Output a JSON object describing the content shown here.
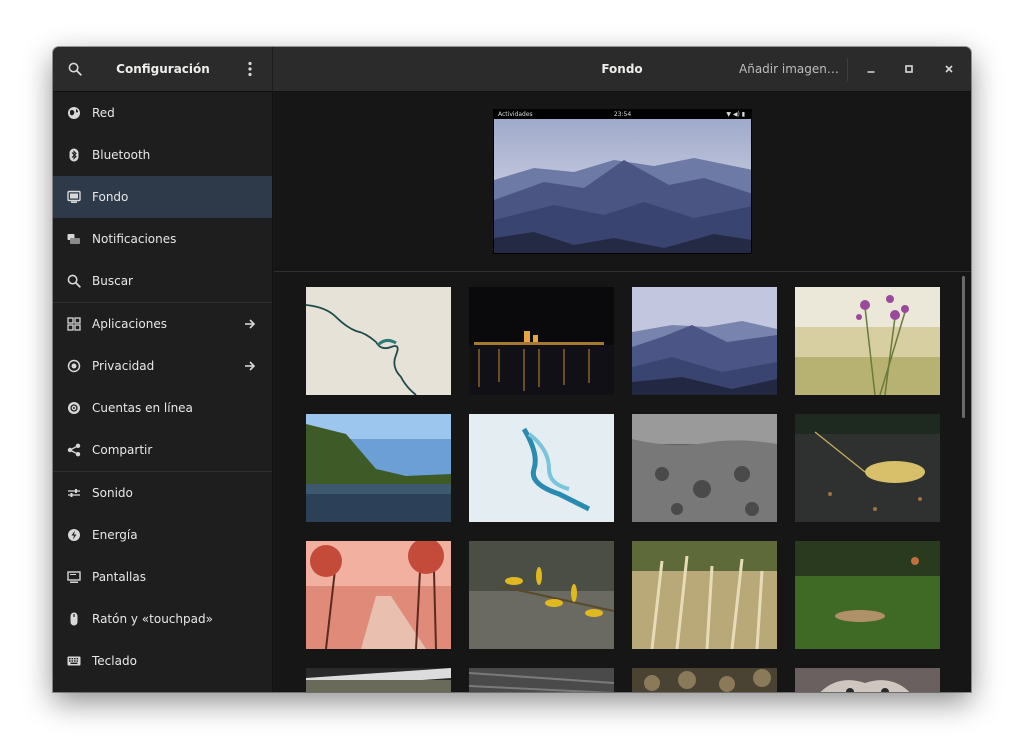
{
  "header": {
    "sidebar_title": "Configuración",
    "title": "Fondo",
    "add_image_label": "Añadir imagen…"
  },
  "sidebar": {
    "items": [
      {
        "label": "Red",
        "icon": "network-icon"
      },
      {
        "label": "Bluetooth",
        "icon": "bluetooth-icon"
      },
      {
        "label": "Fondo",
        "icon": "background-icon",
        "active": true
      },
      {
        "label": "Notificaciones",
        "icon": "notifications-icon"
      },
      {
        "label": "Buscar",
        "icon": "search-icon"
      },
      {
        "label": "Aplicaciones",
        "icon": "apps-icon",
        "arrow": true
      },
      {
        "label": "Privacidad",
        "icon": "privacy-icon",
        "arrow": true
      },
      {
        "label": "Cuentas en línea",
        "icon": "online-accounts-icon"
      },
      {
        "label": "Compartir",
        "icon": "share-icon"
      },
      {
        "label": "Sonido",
        "icon": "sound-icon"
      },
      {
        "label": "Energía",
        "icon": "power-icon"
      },
      {
        "label": "Pantallas",
        "icon": "displays-icon"
      },
      {
        "label": "Ratón y «touchpad»",
        "icon": "mouse-icon"
      },
      {
        "label": "Teclado",
        "icon": "keyboard-icon"
      }
    ]
  },
  "preview": {
    "topbar_left": "Actividades",
    "topbar_time": "23:54",
    "topbar_status": "▼ ◀) ▮"
  },
  "wallpapers": [
    {
      "name": "map-river"
    },
    {
      "name": "night-city-lake"
    },
    {
      "name": "misty-mountains"
    },
    {
      "name": "purple-flowers"
    },
    {
      "name": "forest-river"
    },
    {
      "name": "blue-ice-pattern"
    },
    {
      "name": "grey-rock-texture"
    },
    {
      "name": "autumn-leaf-ground"
    },
    {
      "name": "autumn-park-path"
    },
    {
      "name": "yellow-leaves-branch"
    },
    {
      "name": "golden-grass"
    },
    {
      "name": "green-lawn-leaf"
    },
    {
      "name": "dark-road"
    },
    {
      "name": "grey-wood"
    },
    {
      "name": "pebbles"
    },
    {
      "name": "cat"
    }
  ],
  "colors": {
    "accent_active": "#2e3a4a",
    "sidebar_bg": "#1e1e1e",
    "headerbar_bg": "#2b2b2b",
    "content_bg": "#161616"
  }
}
